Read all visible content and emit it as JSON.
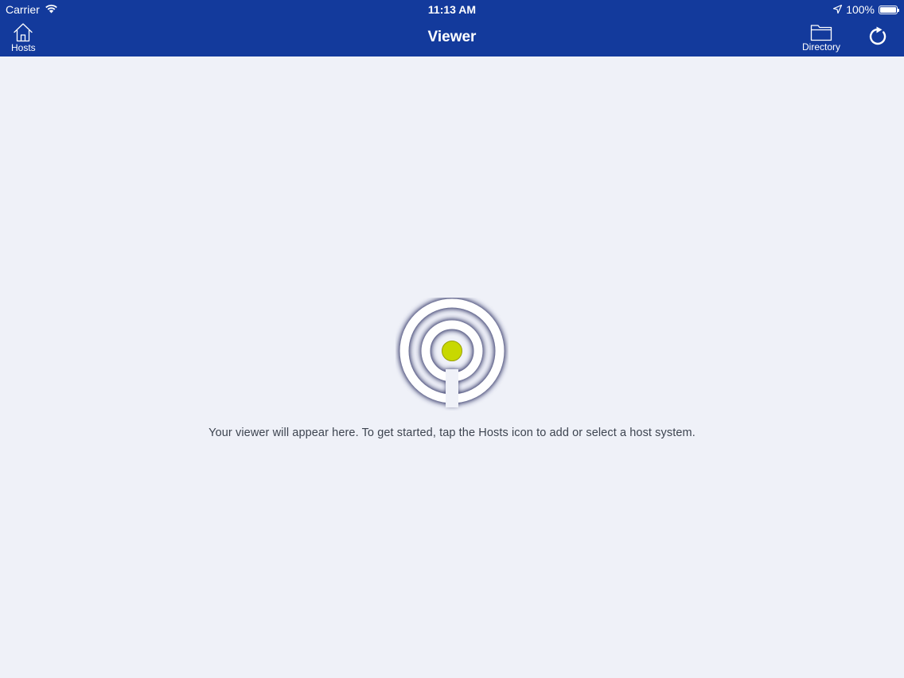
{
  "status_bar": {
    "carrier": "Carrier",
    "time": "11:13 AM",
    "battery": "100%",
    "battery_level": 1.0
  },
  "nav": {
    "title": "Viewer",
    "hosts_label": "Hosts",
    "directory_label": "Directory"
  },
  "main": {
    "message": "Your viewer will appear here. To get started, tap the Hosts icon to add or select a host system."
  },
  "icons": {
    "hosts": "home-icon",
    "directory": "folder-icon",
    "refresh": "refresh-icon",
    "signal": "signal-target-icon"
  },
  "colors": {
    "header": "#133a9c",
    "background": "#eff1f8",
    "signal_dot": "#c8d800"
  }
}
